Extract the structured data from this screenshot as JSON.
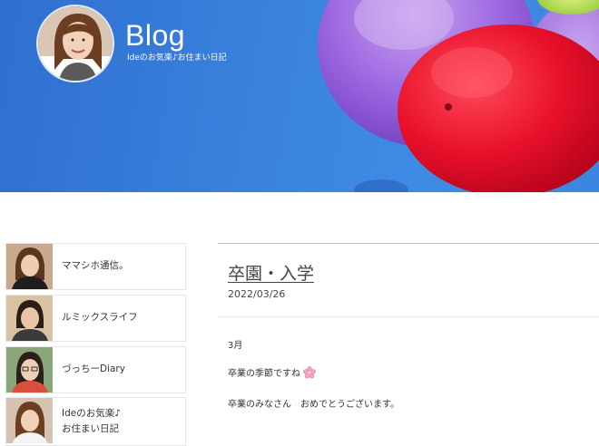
{
  "header": {
    "site_title": "Blog",
    "tagline": "Ideのお気楽♪お住まい日記"
  },
  "sidebar": {
    "items": [
      {
        "label": "ママシホ通信。"
      },
      {
        "label": "ルミックスライフ"
      },
      {
        "label": "づっちーDiary"
      },
      {
        "label_line1": "Ideのお気楽♪",
        "label_line2": "お住まい日記"
      }
    ]
  },
  "post": {
    "title": "卒園・入学",
    "date": "2022/03/26",
    "paragraphs": [
      "3月",
      "卒業の季節ですね",
      "卒業のみなさん　おめでとうございます。"
    ],
    "emoji_icon": "cherry-blossom-icon"
  },
  "colors": {
    "hero_blue": "#3a82de",
    "balloon_red": "#e8102a",
    "balloon_purple": "#8b55d6",
    "balloon_green": "#9ad23a"
  }
}
